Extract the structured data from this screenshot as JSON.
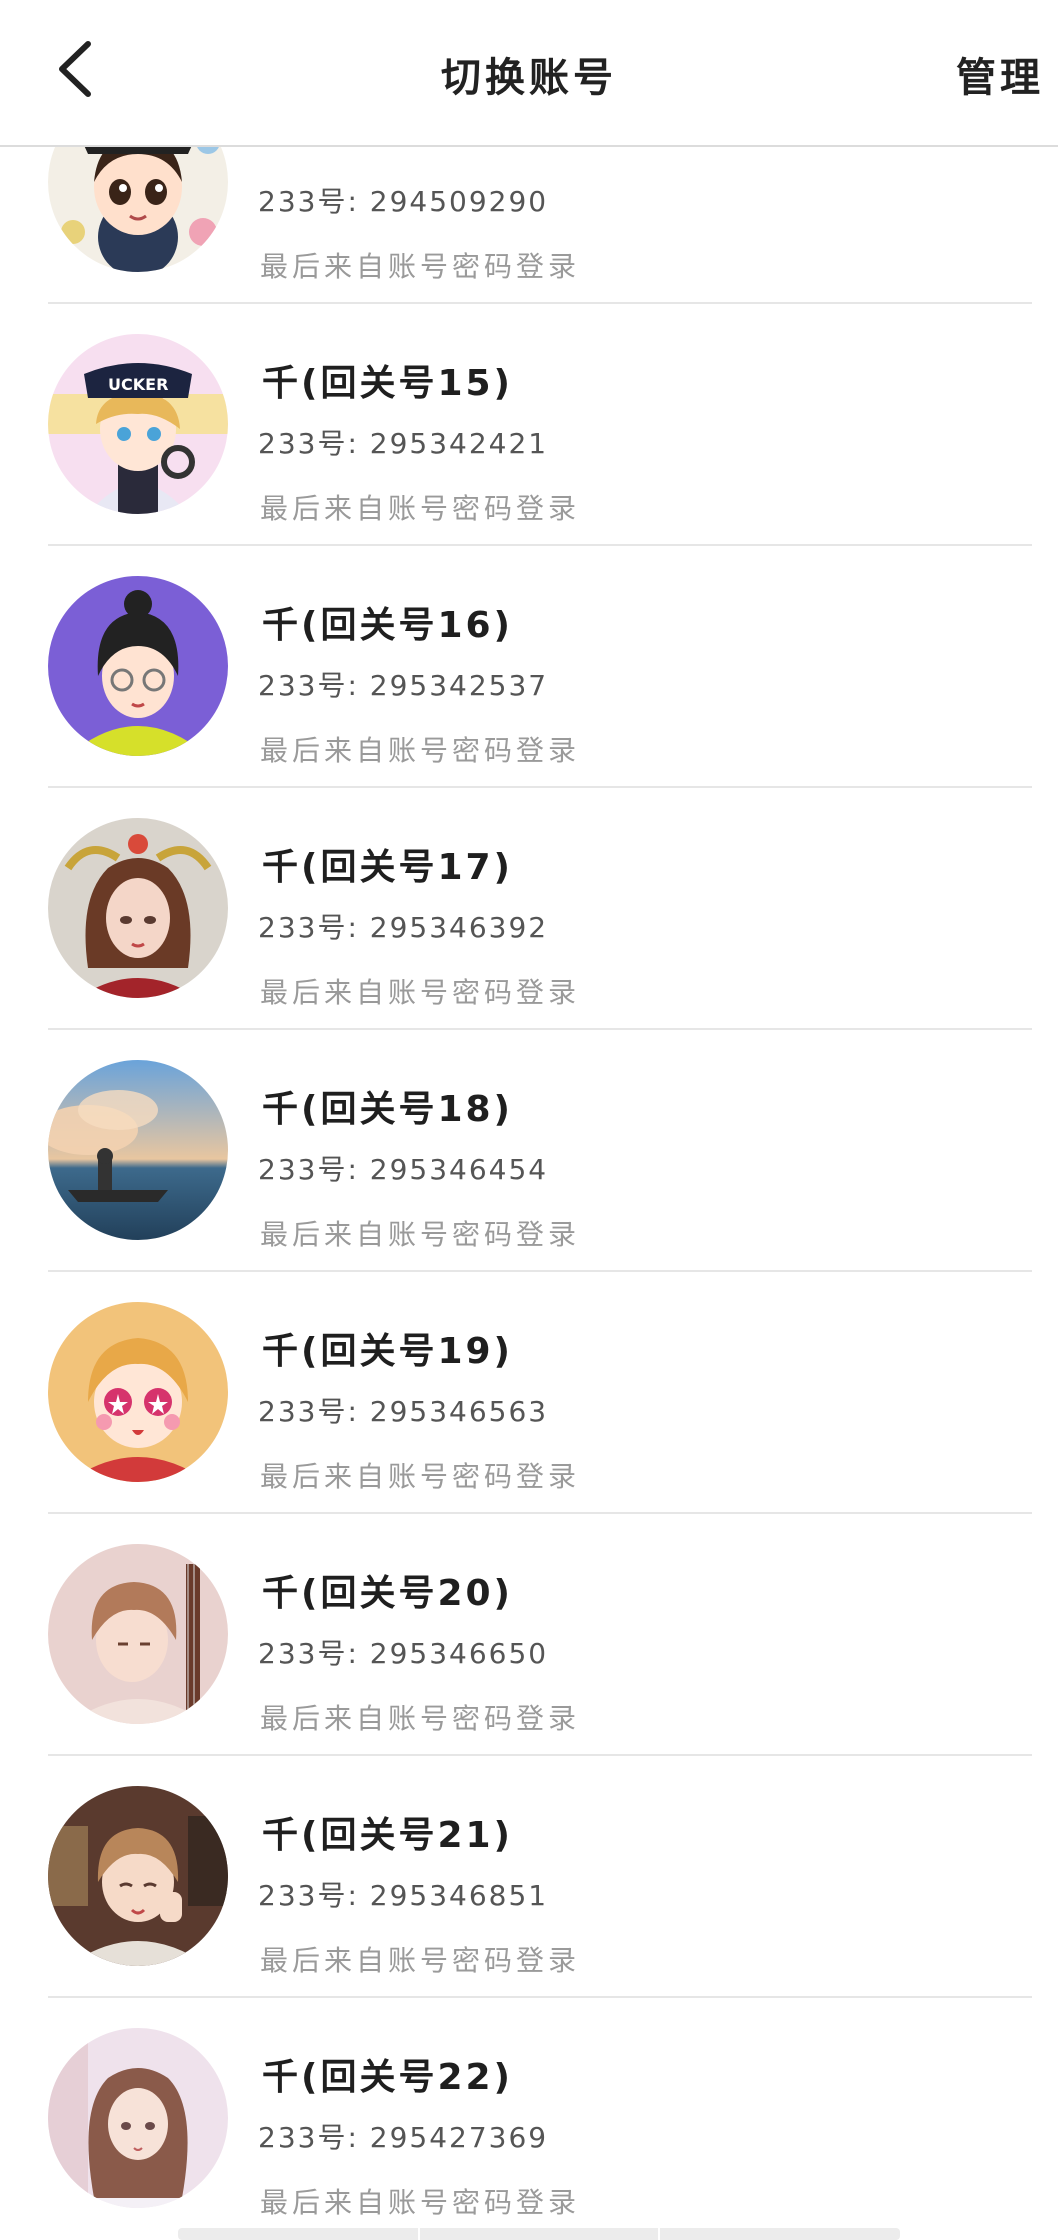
{
  "header": {
    "title": "切换账号",
    "manage_label": "管理"
  },
  "accounts": [
    {
      "name": "",
      "uid": "233号: 294509290",
      "login": "最后来自账号密码登录",
      "avatar": "chibi-girl-flowers"
    },
    {
      "name": "千(回关号15)",
      "uid": "233号: 295342421",
      "login": "最后来自账号密码登录",
      "avatar": "anime-boy-cap"
    },
    {
      "name": "千(回关号16)",
      "uid": "233号: 295342537",
      "login": "最后来自账号密码登录",
      "avatar": "girl-glasses-purple"
    },
    {
      "name": "千(回关号17)",
      "uid": "233号: 295346392",
      "login": "最后来自账号密码登录",
      "avatar": "girl-gold-headdress"
    },
    {
      "name": "千(回关号18)",
      "uid": "233号: 295346454",
      "login": "最后来自账号密码登录",
      "avatar": "sea-sky-scene"
    },
    {
      "name": "千(回关号19)",
      "uid": "233号: 295346563",
      "login": "最后来自账号密码登录",
      "avatar": "anime-girl-star-eyes"
    },
    {
      "name": "千(回关号20)",
      "uid": "233号: 295346650",
      "login": "最后来自账号密码登录",
      "avatar": "anime-boy-guitar"
    },
    {
      "name": "千(回关号21)",
      "uid": "233号: 295346851",
      "login": "最后来自账号密码登录",
      "avatar": "anime-boy-room"
    },
    {
      "name": "千(回关号22)",
      "uid": "233号: 295427369",
      "login": "最后来自账号密码登录",
      "avatar": "anime-girl-pale"
    }
  ]
}
